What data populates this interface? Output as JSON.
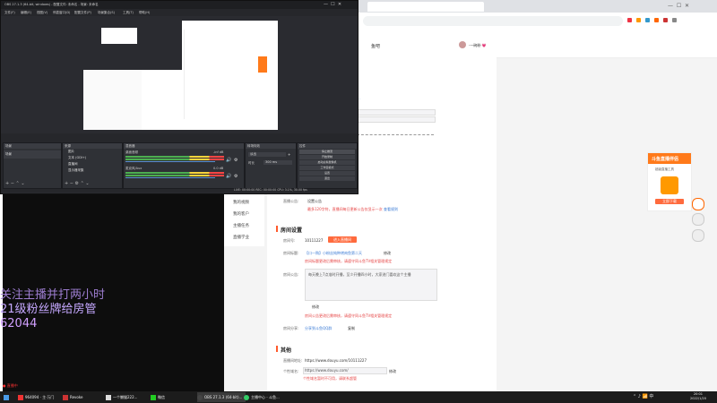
{
  "obs": {
    "title": "OBS 27.1.3 (64-bit, windows) - 配置文件: 未命名 - 场景: 未命名",
    "menu": [
      "文件(F)",
      "编辑(E)",
      "视图(V)",
      "停靠窗口(D)",
      "配置文件(P)",
      "场景集合(S)",
      "工具(T)",
      "帮助(H)"
    ],
    "no_source": "未选择源",
    "props_label": "属性",
    "filters_label": "滤镜",
    "docks": {
      "scenes": "场景",
      "sources": "来源",
      "mixer": "混音器",
      "transitions": "转场特效",
      "controls": "控件"
    },
    "scene_item": "场景",
    "sources": [
      "图片",
      "文本 (GDI+)",
      "直播间",
      "显示器采集"
    ],
    "mixer_tracks": [
      {
        "name": "桌面音频",
        "db": "-inf dB"
      },
      {
        "name": "麦克风/Aux",
        "db": "0.0 dB"
      }
    ],
    "transition": {
      "name": "淡出",
      "duration_label": "时长",
      "duration": "300 ms"
    },
    "controls": [
      "停止推流",
      "开始录制",
      "启动虚拟摄像机",
      "工作室模式",
      "设置",
      "退出"
    ],
    "status": "LIVE: 00:00:00   REC: 00:00:00   CPU: 3.1%, 30.00 fps"
  },
  "browser": {
    "header_nav": [
      "鱼吧"
    ],
    "user": "·一碗粉·💗",
    "menu": [
      "我的视频",
      "我的客户",
      "主播任务",
      "直播学业"
    ],
    "notice_label": "直播公告:",
    "notice_value": "设置公告",
    "notice_warn": "最多120字符，直播间每日更新公告仅显示一次",
    "notice_link": "查看规则",
    "section_room": "房间设置",
    "room_id_label": "房间号:",
    "room_id": "10111227",
    "room_id_btn": "进入直播间",
    "room_title_label": "房间标题:",
    "room_title": "【口一购】小粉丝纯种烤肉鱼第二天",
    "room_title_edit": "修改",
    "room_title_warn": "房间标题更改后需审核，请遵守同斗鱼TV相关管理规定",
    "room_desc_label": "房间公告:",
    "room_desc": "每天晚上7点准时开播，至少开播四小时，大家进门喜欢这个主播",
    "room_desc_edit": "修改",
    "room_desc_warn": "房间公告更改后需审核，请遵守同斗鱼TV相关管理规定",
    "share_label": "房间分享:",
    "share_link": "分享到斗鱼QQ群",
    "share_btn": "复制",
    "section_other": "其他",
    "addr_label": "直播间地址:",
    "addr": "https://www.douyu.com/10111227",
    "custom_label": "个性域名:",
    "custom_placeholder": "https://www.douyu.com/",
    "custom_btn": "修改",
    "custom_warn": "个性域名暂时不可用，请联系超管",
    "promo_title": "斗鱼直播伴侣",
    "promo_sub": "超级直播工具",
    "promo_btn": "立即下载"
  },
  "overlay": {
    "lines": [
      "关注主播并打两小时",
      "21级粉丝牌给房管",
      "62044"
    ]
  },
  "taskbar": {
    "items": [
      "964094 · 主·万门",
      "Revoke",
      "一个懒猫222...",
      "微信",
      "OBS 27.1.3 (64-bit)...",
      "主播中心 - 斗鱼..."
    ],
    "search": "搜索",
    "time": "20:01",
    "date": "2022/1/20",
    "bottom_text": "黑自烧样科工提   编版"
  },
  "colors": {
    "accent": "#ff5a2c",
    "pink": "#e5457a",
    "obs_bg": "#2a2b30"
  }
}
